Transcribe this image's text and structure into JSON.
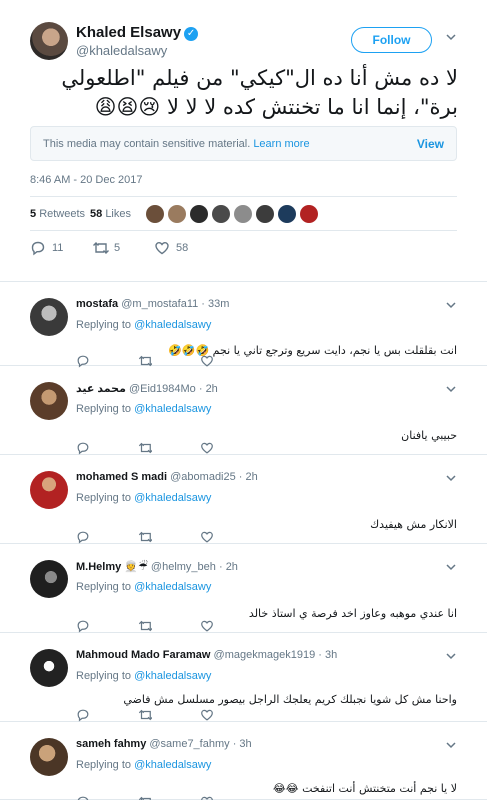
{
  "main_tweet": {
    "author_name": "Khaled Elsawy",
    "author_handle": "@khaledalsawy",
    "follow_label": "Follow",
    "text": "لا ده مش أنا ده ال\"كيكي\" من فيلم \"اطلعولي برة\"، إنما انا ما تخنتش كده لا لا لا 😢😫😩",
    "media_notice": "This media may contain sensitive material.",
    "learn_more": "Learn more",
    "view_label": "View",
    "timestamp": "8:46 AM - 20 Dec 2017",
    "retweets_count": "5",
    "retweets_label": "Retweets",
    "likes_count": "58",
    "likes_label": "Likes",
    "reply_count": "11",
    "retweet_count": "5",
    "like_count": "58"
  },
  "replies": [
    {
      "name": "mostafa",
      "handle": "@m_mostafa11",
      "time": "33m",
      "replying_label": "Replying to",
      "replying_to": "@khaledalsawy",
      "text": "انت بقلقلت بس يا نجم، دايت سريع وترجع تاني يا نجم 🤣🤣🤣"
    },
    {
      "name": "محمد عيد",
      "handle": "@Eid1984Mo",
      "time": "2h",
      "replying_label": "Replying to",
      "replying_to": "@khaledalsawy",
      "text": "حبيبي يافنان"
    },
    {
      "name": "mohamed S madi",
      "handle": "@abomadi25",
      "time": "2h",
      "replying_label": "Replying to",
      "replying_to": "@khaledalsawy",
      "text": "الانكار مش هيفيدك"
    },
    {
      "name": "M.Helmy 👳☔",
      "handle": "@helmy_beh",
      "time": "2h",
      "replying_label": "Replying to",
      "replying_to": "@khaledalsawy",
      "text": "انا عندي موهبه وعاوز اخد فرصة ي استاذ خالد"
    },
    {
      "name": "Mahmoud Mado Faramaw",
      "handle": "@magekmagek1919",
      "time": "3h",
      "replying_label": "Replying to",
      "replying_to": "@khaledalsawy",
      "text": "واحنا مش كل شويا نجبلك كريم يعلجك   الراجل بيصور مسلسل مش فاضي"
    },
    {
      "name": "sameh fahmy",
      "handle": "@same7_fahmy",
      "time": "3h",
      "replying_label": "Replying to",
      "replying_to": "@khaledalsawy",
      "text": "لا يا نجم أنت متخنتش أنت اتنفخت 😂😂"
    }
  ],
  "icons": {
    "reply": "reply-icon",
    "retweet": "retweet-icon",
    "like": "heart-icon",
    "caret": "chevron-down-icon",
    "verified": "verified-badge-icon"
  },
  "colors": {
    "accent": "#1da1f2",
    "link": "#1b95e0",
    "muted": "#657786",
    "text": "#14171a",
    "border": "#e1e8ed"
  }
}
